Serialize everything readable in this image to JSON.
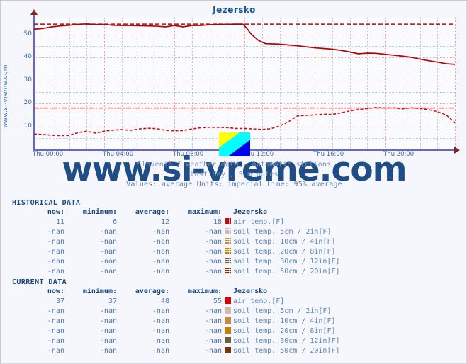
{
  "page": {
    "background": "#f6f7fd",
    "border_color": "#c8c8d0"
  },
  "chart": {
    "title": "Jezersko",
    "side_label": "www.si-vreme.com",
    "watermark": "www.si-vreme.com",
    "caption_line1": "Slovenia / weather data - automatic stations",
    "caption_line2": "last day , 5 minutes",
    "caption_line3": "Values: average  Units: imperial  Line: 95% average",
    "broken_image_icon": "broken-image-icon"
  },
  "chart_data": {
    "type": "line",
    "title": "Jezersko",
    "xlabel": "",
    "ylabel": "",
    "xlim": [
      0,
      24
    ],
    "ylim": [
      0,
      57
    ],
    "ytick_labels": [
      "10",
      "20",
      "30",
      "40",
      "50"
    ],
    "ytick_values": [
      10,
      20,
      30,
      40,
      50
    ],
    "xtick_labels": [
      "Thu 00:00",
      "Thu 04:00",
      "Thu 08:00",
      "Thu 12:00",
      "Thu 16:00",
      "Thu 20:00"
    ],
    "xtick_values": [
      0,
      4,
      8,
      12,
      16,
      20
    ],
    "grid": true,
    "units": "imperial",
    "legend_position": "below-as-table",
    "reference_lines": [
      {
        "name": "current-95pct-average",
        "value": 54.5,
        "color": "#cc0000",
        "style": "dashed"
      },
      {
        "name": "historical-95pct-average",
        "value": 18.0,
        "color": "#cc0000",
        "style": "dash-dot"
      }
    ],
    "series": [
      {
        "name": "air temp. [F] - current",
        "color": "#bb0000",
        "style": "solid",
        "x": [
          0,
          0.5,
          1,
          1.5,
          2,
          2.5,
          3,
          3.5,
          4,
          4.5,
          5,
          5.5,
          6,
          6.5,
          7,
          7.5,
          8,
          8.5,
          9,
          9.5,
          10,
          10.5,
          11,
          11.5,
          11.9,
          12.1,
          12.4,
          12.8,
          13.2,
          13.6,
          14,
          15,
          16,
          16.5,
          17,
          17.5,
          18,
          18.5,
          19,
          19.5,
          20,
          20.5,
          21,
          21.5,
          22,
          22.5,
          23,
          23.5,
          24
        ],
        "y": [
          52.3,
          52.6,
          53.3,
          53.7,
          54.0,
          54.4,
          54.6,
          54.3,
          54.4,
          54.0,
          53.9,
          53.9,
          53.8,
          53.7,
          53.6,
          53.3,
          53.9,
          53.3,
          53.9,
          53.9,
          54.2,
          54.4,
          54.4,
          54.5,
          54.5,
          53.0,
          50.0,
          47.4,
          46.0,
          45.9,
          45.8,
          45.1,
          44.2,
          43.9,
          43.6,
          43.1,
          42.4,
          41.6,
          41.9,
          41.8,
          41.4,
          41.0,
          40.6,
          40.1,
          39.3,
          38.6,
          38.0,
          37.3,
          37.0
        ]
      },
      {
        "name": "air temp. [F] - historical",
        "color": "#cc1111",
        "style": "dashed",
        "x": [
          0,
          0.5,
          1,
          1.5,
          2,
          2.5,
          3,
          3.5,
          4,
          4.5,
          5,
          5.5,
          6,
          6.5,
          7,
          7.5,
          8,
          8.5,
          9,
          9.5,
          10,
          10.5,
          11,
          11.5,
          12,
          12.5,
          13,
          13.5,
          14,
          14.5,
          15,
          15.5,
          16,
          16.5,
          17,
          17.5,
          18,
          18.5,
          19,
          19.5,
          20,
          20.5,
          21,
          21.5,
          22,
          22.5,
          23,
          23.5,
          24
        ],
        "y": [
          6.7,
          6.5,
          6.2,
          6.0,
          6.1,
          7.3,
          7.9,
          7.1,
          7.9,
          8.4,
          8.6,
          8.3,
          8.9,
          9.2,
          9.0,
          8.3,
          8.1,
          8.2,
          8.9,
          9.4,
          9.6,
          9.6,
          9.5,
          9.1,
          9.1,
          8.9,
          8.7,
          9.0,
          10.2,
          12.0,
          14.5,
          14.8,
          15.0,
          15.3,
          15.2,
          15.9,
          16.7,
          17.3,
          17.8,
          18.2,
          18.0,
          18.1,
          17.6,
          18.1,
          17.8,
          17.3,
          16.4,
          15.0,
          11.6
        ]
      }
    ]
  },
  "historical": {
    "section_title": "HISTORICAL DATA",
    "headers": {
      "now": "now:",
      "minimum": "minimum:",
      "average": "average:",
      "maximum": "maximum:",
      "station": "Jezersko"
    },
    "rows": [
      {
        "now": "11",
        "minimum": "6",
        "average": "12",
        "maximum": "18",
        "color": "#dd0000",
        "label": "air temp.[F]"
      },
      {
        "now": "-nan",
        "minimum": "-nan",
        "average": "-nan",
        "maximum": "-nan",
        "color": "#d8b6b0",
        "label": "soil temp. 5cm / 2in[F]"
      },
      {
        "now": "-nan",
        "minimum": "-nan",
        "average": "-nan",
        "maximum": "-nan",
        "color": "#c08b45",
        "label": "soil temp. 10cm / 4in[F]"
      },
      {
        "now": "-nan",
        "minimum": "-nan",
        "average": "-nan",
        "maximum": "-nan",
        "color": "#c08000",
        "label": "soil temp. 20cm / 8in[F]"
      },
      {
        "now": "-nan",
        "minimum": "-nan",
        "average": "-nan",
        "maximum": "-nan",
        "color": "#6b6042",
        "label": "soil temp. 30cm / 12in[F]"
      },
      {
        "now": "-nan",
        "minimum": "-nan",
        "average": "-nan",
        "maximum": "-nan",
        "color": "#76380a",
        "label": "soil temp. 50cm / 20in[F]"
      }
    ]
  },
  "current": {
    "section_title": "CURRENT DATA",
    "headers": {
      "now": "now:",
      "minimum": "minimum:",
      "average": "average:",
      "maximum": "maximum:",
      "station": "Jezersko"
    },
    "rows": [
      {
        "now": "37",
        "minimum": "37",
        "average": "48",
        "maximum": "55",
        "color": "#dd0000",
        "label": "air temp.[F]"
      },
      {
        "now": "-nan",
        "minimum": "-nan",
        "average": "-nan",
        "maximum": "-nan",
        "color": "#d8b6b0",
        "label": "soil temp. 5cm / 2in[F]"
      },
      {
        "now": "-nan",
        "minimum": "-nan",
        "average": "-nan",
        "maximum": "-nan",
        "color": "#c08b45",
        "label": "soil temp. 10cm / 4in[F]"
      },
      {
        "now": "-nan",
        "minimum": "-nan",
        "average": "-nan",
        "maximum": "-nan",
        "color": "#c08000",
        "label": "soil temp. 20cm / 8in[F]"
      },
      {
        "now": "-nan",
        "minimum": "-nan",
        "average": "-nan",
        "maximum": "-nan",
        "color": "#6b6042",
        "label": "soil temp. 30cm / 12in[F]"
      },
      {
        "now": "-nan",
        "minimum": "-nan",
        "average": "-nan",
        "maximum": "-nan",
        "color": "#76380a",
        "label": "soil temp. 50cm / 20in[F]"
      }
    ]
  }
}
